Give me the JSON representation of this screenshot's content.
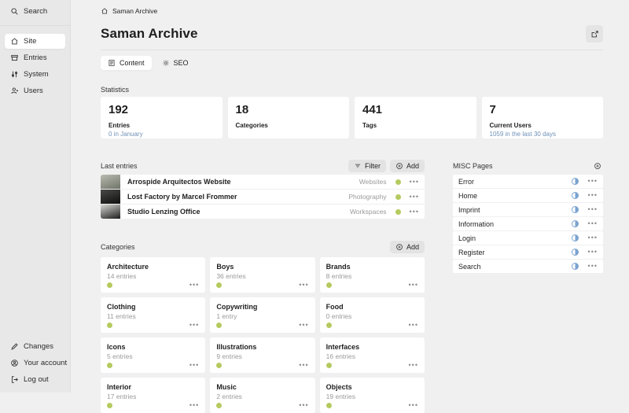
{
  "colors": {
    "status_green": "#b5ca5f",
    "status_blue": "#7ba3cf",
    "link_blue": "#6f91b8",
    "sidebar_bg": "#e8e8e8",
    "page_bg": "#f0f0f0"
  },
  "sidebar": {
    "search_label": "Search",
    "items": [
      {
        "label": "Site",
        "icon": "home-icon",
        "active": true
      },
      {
        "label": "Entries",
        "icon": "archive-icon",
        "active": false
      },
      {
        "label": "System",
        "icon": "sliders-icon",
        "active": false
      },
      {
        "label": "Users",
        "icon": "users-icon",
        "active": false
      }
    ],
    "footer": [
      {
        "label": "Changes",
        "icon": "pencil-icon"
      },
      {
        "label": "Your account",
        "icon": "account-icon"
      },
      {
        "label": "Log out",
        "icon": "logout-icon"
      }
    ]
  },
  "header": {
    "breadcrumb": "Saman Archive",
    "title": "Saman Archive",
    "tabs": [
      {
        "label": "Content",
        "icon": "document-icon",
        "active": true
      },
      {
        "label": "SEO",
        "icon": "sun-icon",
        "active": false
      }
    ]
  },
  "statistics": {
    "label": "Statistics",
    "cards": [
      {
        "value": "192",
        "label": "Entries",
        "link": "0 in January"
      },
      {
        "value": "18",
        "label": "Categories",
        "link": ""
      },
      {
        "value": "441",
        "label": "Tags",
        "link": ""
      },
      {
        "value": "7",
        "label": "Current Users",
        "link": "1059 in the last 30 days"
      }
    ]
  },
  "last_entries": {
    "label": "Last entries",
    "filter_label": "Filter",
    "add_label": "Add",
    "rows": [
      {
        "title": "Arrospide Arquitectos Website",
        "tag": "Websites",
        "status": "published",
        "thumb": [
          "#b9bbae",
          "#6f746a"
        ]
      },
      {
        "title": "Lost Factory by Marcel Frommer",
        "tag": "Photography",
        "status": "published",
        "thumb": [
          "#4a4a48",
          "#101010"
        ]
      },
      {
        "title": "Studio Lenzing Office",
        "tag": "Workspaces",
        "status": "published",
        "thumb": [
          "#d8d8d4",
          "#1c1c1c"
        ]
      }
    ]
  },
  "misc_pages": {
    "label": "MISC Pages",
    "items": [
      {
        "label": "Error",
        "status": "unlisted"
      },
      {
        "label": "Home",
        "status": "unlisted"
      },
      {
        "label": "Imprint",
        "status": "unlisted"
      },
      {
        "label": "Information",
        "status": "unlisted"
      },
      {
        "label": "Login",
        "status": "unlisted"
      },
      {
        "label": "Register",
        "status": "unlisted"
      },
      {
        "label": "Search",
        "status": "unlisted"
      }
    ]
  },
  "categories": {
    "label": "Categories",
    "add_label": "Add",
    "cards": [
      {
        "title": "Architecture",
        "entries": "14 entries"
      },
      {
        "title": "Boys",
        "entries": "36 entries"
      },
      {
        "title": "Brands",
        "entries": "8 entries"
      },
      {
        "title": "Clothing",
        "entries": "11 entries"
      },
      {
        "title": "Copywriting",
        "entries": "1 entry"
      },
      {
        "title": "Food",
        "entries": "0 entries"
      },
      {
        "title": "Icons",
        "entries": "5 entries"
      },
      {
        "title": "Illustrations",
        "entries": "9 entries"
      },
      {
        "title": "Interfaces",
        "entries": "16 entries"
      },
      {
        "title": "Interior",
        "entries": "17 entries"
      },
      {
        "title": "Music",
        "entries": "2 entries"
      },
      {
        "title": "Objects",
        "entries": "19 entries"
      }
    ]
  }
}
